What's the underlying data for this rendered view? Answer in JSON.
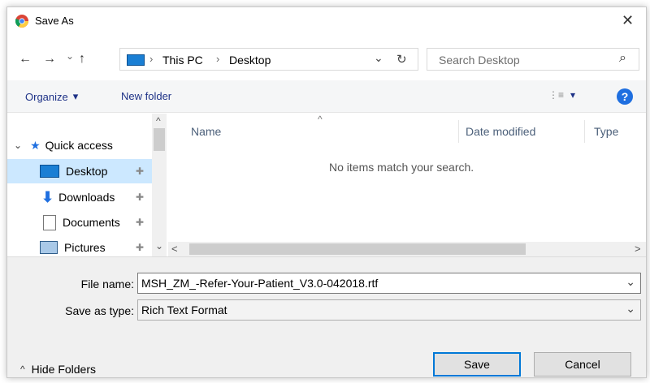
{
  "window": {
    "title": "Save As",
    "close_glyph": "✕"
  },
  "nav": {
    "back_glyph": "←",
    "forward_glyph": "→",
    "recent_glyph": "⌄",
    "up_glyph": "↑",
    "breadcrumb": [
      "This PC",
      "Desktop"
    ],
    "sep_glyph": "›",
    "address_dropdown_glyph": "⌄",
    "refresh_glyph": "↻",
    "search_placeholder": "Search Desktop",
    "search_glyph": "⌕"
  },
  "toolbar": {
    "organize_label": "Organize",
    "organize_caret": "▾",
    "new_folder_label": "New folder",
    "view_glyph": "⋮≡",
    "view_caret": "▾",
    "help_glyph": "?"
  },
  "sidebar": {
    "quick_access_label": "Quick access",
    "expand_glyph": "⌄",
    "items": [
      {
        "label": "Desktop",
        "pin": "📌"
      },
      {
        "label": "Downloads",
        "pin": "📌"
      },
      {
        "label": "Documents",
        "pin": "📌"
      },
      {
        "label": "Pictures",
        "pin": "📌"
      }
    ],
    "scroll_up_glyph": "^",
    "scroll_down_glyph": "⌄"
  },
  "content": {
    "sort_glyph": "^",
    "columns": [
      "Name",
      "Date modified",
      "Type"
    ],
    "empty_message": "No items match your search.",
    "hscroll_left_glyph": "<",
    "hscroll_right_glyph": ">"
  },
  "form": {
    "file_name_label": "File name:",
    "file_name_value": "MSH_ZM_-Refer-Your-Patient_V3.0-042018.rtf",
    "save_type_label": "Save as type:",
    "save_type_value": "Rich Text Format",
    "combo_glyph": "⌄"
  },
  "footer": {
    "hide_folders_glyph": "^",
    "hide_folders_label": "Hide Folders",
    "save_label": "Save",
    "cancel_label": "Cancel"
  },
  "colors": {
    "accent": "#0078d7",
    "selection": "#cce8ff",
    "link": "#1e3287"
  }
}
